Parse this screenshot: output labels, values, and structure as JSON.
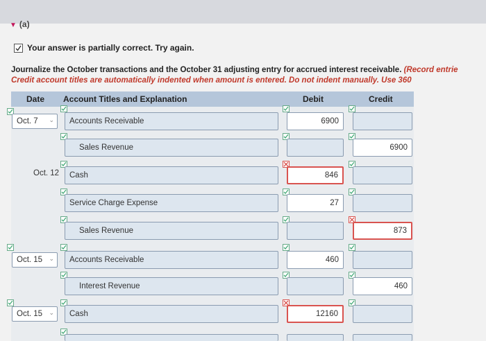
{
  "section": {
    "label": "(a)"
  },
  "status": {
    "text": "Your answer is partially correct.  Try again."
  },
  "instructions": {
    "line1": "Journalize the October transactions and the October 31 adjusting entry for accrued interest receivable.",
    "line1_red": "(Record entrie",
    "line2_red": "Credit account titles are automatically indented when amount is entered. Do not indent manually. Use 360"
  },
  "table": {
    "headers": {
      "date": "Date",
      "account": "Account Titles and Explanation",
      "debit": "Debit",
      "credit": "Credit"
    }
  },
  "rows": [
    {
      "date": "Oct. 7",
      "account": "Accounts Receivable",
      "debit": "6900",
      "credit": ""
    },
    {
      "date": "",
      "account": "Sales Revenue",
      "debit": "",
      "credit": "6900"
    },
    {
      "date": "Oct. 12",
      "account": "Cash",
      "debit": "846",
      "credit": ""
    },
    {
      "date": "",
      "account": "Service Charge Expense",
      "debit": "27",
      "credit": ""
    },
    {
      "date": "",
      "account": "Sales Revenue",
      "debit": "",
      "credit": "873"
    },
    {
      "date": "Oct. 15",
      "account": "Accounts Receivable",
      "debit": "460",
      "credit": ""
    },
    {
      "date": "",
      "account": "Interest Revenue",
      "debit": "",
      "credit": "460"
    },
    {
      "date": "Oct. 15",
      "account": "Cash",
      "debit": "12160",
      "credit": ""
    }
  ]
}
